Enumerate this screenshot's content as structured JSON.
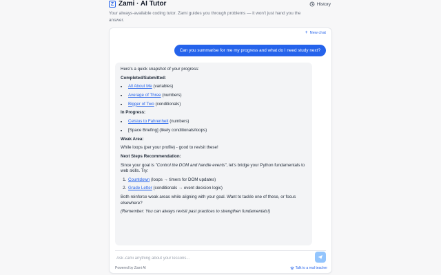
{
  "header": {
    "logo_glyph": "Z",
    "title": "Zami · AI Tutor",
    "subtitle": "Your always-available coding tutor. Zami guides you through problems — it won't just hand you the answer.",
    "history_label": "History"
  },
  "chat": {
    "new_chat_label": "New chat",
    "user_message": "Can you summarise for me my progress and what do I need study next?",
    "assistant": {
      "intro": "Here's a quick snapshot of your progress:",
      "completed_heading": "Completed/Submitted:",
      "completed_items": [
        {
          "link": "All About Me",
          "note": " (variables)"
        },
        {
          "link": "Average of Three",
          "note": " (numbers)"
        },
        {
          "link": "Bigger of Two",
          "note": " (conditionals)"
        }
      ],
      "in_progress_heading": "In Progress:",
      "in_progress_items": [
        {
          "link": "Celsius to Fahrenheit",
          "note": " (numbers)"
        },
        {
          "text": "[Space Briefing] (likely conditionals/loops)"
        }
      ],
      "weak_heading": "Weak Area:",
      "weak_text": "While loops (per your profile) - good to revisit these!",
      "next_heading": "Next Steps Recommendation:",
      "next_pre": "Since your goal is ",
      "next_goal": "\"Control the DOM and handle events\"",
      "next_post": ", let's bridge your Python fundamentals to web skills. Try:",
      "next_items": [
        {
          "link": "Countdown",
          "note": " (loops → timers for DOM updates)"
        },
        {
          "link": "Grade Letter",
          "note": " (conditionals → event decision logic)"
        }
      ],
      "closing": "Both reinforce weak areas while aligning with your goal. Want to tackle one of these, or focus elsewhere?",
      "reminder": "(Remember: You can always revisit past practices to strengthen fundamentals!)"
    }
  },
  "input": {
    "placeholder": "Ask Zami anything about your lessons...",
    "value": ""
  },
  "footer": {
    "powered_by": "Powered by Zami AI",
    "talk_label": "Talk to a real teacher"
  },
  "colors": {
    "accent": "#2563eb",
    "send_button": "#93c5fd",
    "assistant_bg": "#f3f4f6"
  }
}
